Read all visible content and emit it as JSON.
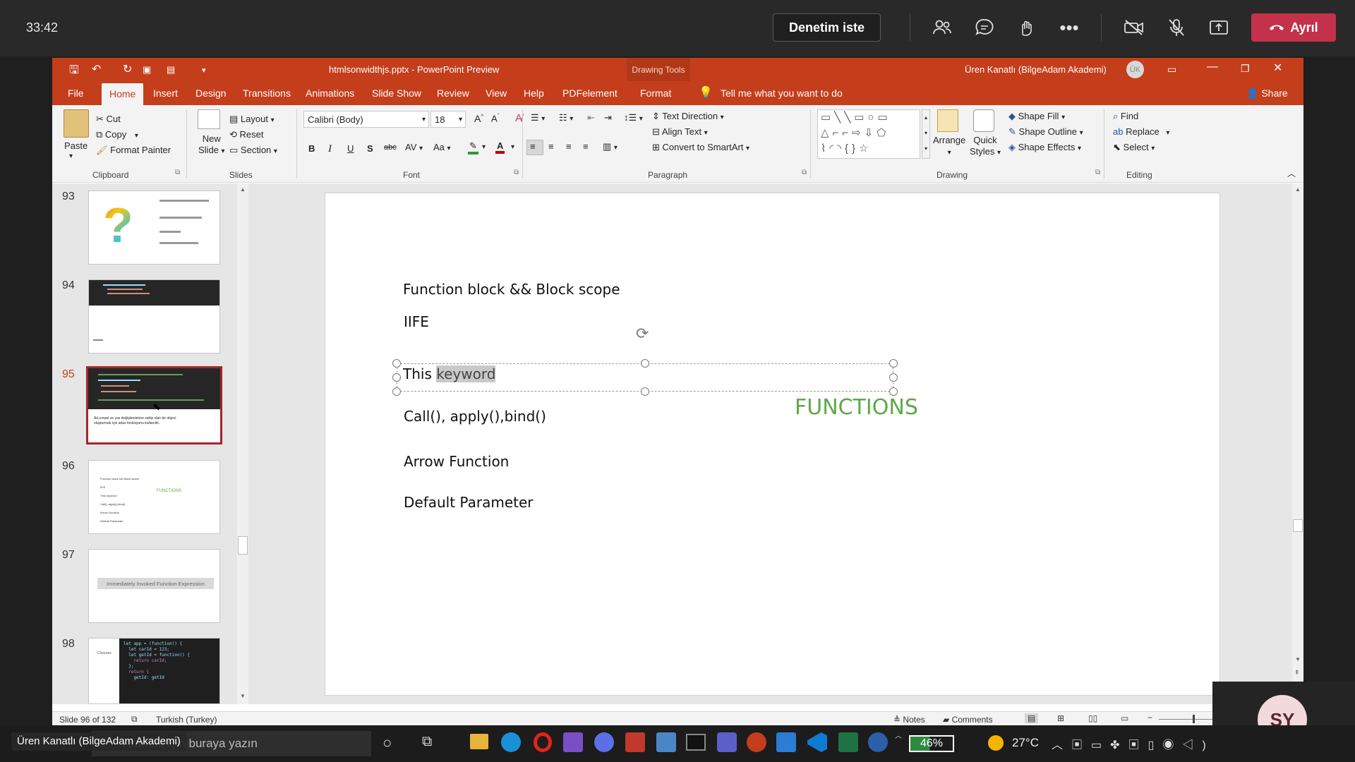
{
  "teams": {
    "time": "33:42",
    "request_control": "Denetim iste",
    "leave": "Ayrıl",
    "icons": [
      "participants-icon",
      "chat-icon",
      "reactions-icon",
      "more-icon",
      "camera-off-icon",
      "mic-off-icon",
      "share-tray-icon"
    ]
  },
  "powerpoint": {
    "title": "htmlsonwidthjs.pptx  -  PowerPoint Preview",
    "contextual": "Drawing Tools",
    "user": "Üren Kanatlı (BilgeAdam Akademi)",
    "user_initials": "ÜK",
    "tabs": [
      "File",
      "Home",
      "Insert",
      "Design",
      "Transitions",
      "Animations",
      "Slide Show",
      "Review",
      "View",
      "Help",
      "PDFelement",
      "Format"
    ],
    "active_tab": "Home",
    "tell_me": "Tell me what you want to do",
    "share": "Share",
    "ribbon": {
      "clipboard": {
        "paste": "Paste",
        "cut": "Cut",
        "copy": "Copy",
        "format_painter": "Format Painter",
        "label": "Clipboard"
      },
      "slides": {
        "new_slide_1": "New",
        "new_slide_2": "Slide",
        "layout": "Layout",
        "reset": "Reset",
        "section": "Section",
        "label": "Slides"
      },
      "font": {
        "name": "Calibri (Body)",
        "size": "18",
        "label": "Font"
      },
      "paragraph": {
        "text_direction": "Text Direction",
        "align_text": "Align Text",
        "convert": "Convert to SmartArt",
        "label": "Paragraph"
      },
      "drawing": {
        "arrange": "Arrange",
        "quick_1": "Quick",
        "quick_2": "Styles",
        "shape_fill": "Shape Fill",
        "shape_outline": "Shape Outline",
        "shape_effects": "Shape Effects",
        "label": "Drawing"
      },
      "editing": {
        "find": "Find",
        "replace": "Replace",
        "select": "Select",
        "label": "Editing"
      }
    },
    "thumbnails": [
      {
        "num": "93"
      },
      {
        "num": "94"
      },
      {
        "num": "95",
        "caption": "ArLcorpel ve yas değişkenlerine sahip olan bir objeci oluşturmak için adas fonksiyonu kullanılık."
      },
      {
        "num": "96",
        "mini": [
          "Function block && Block scope",
          "IIFE",
          "This keyword",
          "Call(), apply(),bind()",
          "Arrow Function",
          "Default Parameter"
        ],
        "mini_title": "FUNCTIONS"
      },
      {
        "num": "97",
        "mini_box": "Immediately Invoked Function Expression"
      },
      {
        "num": "98",
        "code": [
          "let app = (function() {",
          "  let carId = 123;",
          "  let getId = function() {",
          "    return carId;",
          "  };",
          "  return {",
          "    getId: getId"
        ],
        "side": "Closures"
      }
    ],
    "slide": {
      "lines": [
        "Function block && Block scope",
        "IIFE",
        "This ",
        "keyword",
        "Call(), apply(),bind()",
        "Arrow Function",
        "Default Parameter"
      ],
      "title": "FUNCTIONS"
    },
    "status": {
      "slide": "Slide 96 of 132",
      "language": "Turkish (Turkey)",
      "notes": "Notes",
      "comments": "Comments"
    }
  },
  "taskbar": {
    "search": "Aramak için buraya yazın",
    "battery": "46%",
    "temp": "27°C"
  },
  "presenter_name": "Üren Kanatlı (BilgeAdam Akademi)",
  "self_initials": "SY"
}
